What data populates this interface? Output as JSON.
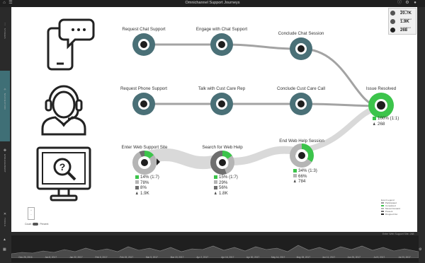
{
  "app": {
    "title": "Omnichannel Support Journeys"
  },
  "leftnav": {
    "items": [
      {
        "label": "STAGES"
      },
      {
        "label": "NAVIGATION"
      },
      {
        "label": "ENGAGEMENT"
      },
      {
        "label": "TOOLS"
      }
    ]
  },
  "stats": {
    "people": {
      "label": "People",
      "value": "20.7K"
    },
    "participated": {
      "label": "Participated",
      "value": "1.9K"
    },
    "completed": {
      "label": "Completed",
      "value": "268"
    }
  },
  "colors": {
    "node": "#4a7077",
    "green": "#3cc44b",
    "gray": "#b5b5b5",
    "dark": "#6e6e6e",
    "edge": "#a3a3a3",
    "edgeLight": "#d9d9d9"
  },
  "channels": [
    {
      "name": "chat-phone-icon"
    },
    {
      "name": "support-agent-icon"
    },
    {
      "name": "web-help-monitor-icon"
    }
  ],
  "nodes": {
    "chat1": {
      "label": "Request Chat Support"
    },
    "chat2": {
      "label": "Engage with Chat Support"
    },
    "chat3": {
      "label": "Conclude Chat Session"
    },
    "phone1": {
      "label": "Request Phone Support"
    },
    "phone2": {
      "label": "Talk with Cust Care Rep"
    },
    "phone3": {
      "label": "Conclude Cust Care Call"
    },
    "web1": {
      "label": "Enter Web Support Site",
      "pct_green": 14,
      "pct_gray": 78,
      "pct_dark": 8,
      "stats": [
        "14% (1:7)",
        "78%",
        "8%",
        "1.9K"
      ]
    },
    "web2": {
      "label": "Search for Web Help",
      "pct_green": 15,
      "pct_gray": 29,
      "pct_dark": 56,
      "stats": [
        "15% (1:7)",
        "29%",
        "56%",
        "1.8K"
      ]
    },
    "web3": {
      "label": "End Web Help Session",
      "pct_green": 34,
      "pct_gray": 66,
      "pct_dark": 0,
      "stats": [
        "34% (1:3)",
        "66%",
        "784"
      ]
    },
    "resolved": {
      "label": "Issue Resolved",
      "pct_green": 100,
      "stats": [
        "100% (1:1)",
        "268"
      ]
    }
  },
  "legend": {
    "title": "Event Legend",
    "items": [
      "Participated",
      "Completed",
      "Moved Forward",
      "Present",
      "Dropped Out"
    ]
  },
  "toggle": {
    "left": "Count",
    "right": "Percent"
  },
  "footnote": "Enter Web Support Site: 268",
  "timeline": {
    "ticks": [
      "Dec 25, 2016",
      "Jan 8, 2017",
      "Jan 22, 2017",
      "Feb 5, 2017",
      "Feb 19, 2017",
      "Mar 5, 2017",
      "Mar 19, 2017",
      "Apr 2, 2017",
      "Apr 16, 2017",
      "Apr 30, 2017",
      "May 14, 2017",
      "May 28, 2017",
      "Jun 11, 2017",
      "Jun 25, 2017",
      "Jul 9, 2017",
      "Jul 23, 2017"
    ]
  }
}
